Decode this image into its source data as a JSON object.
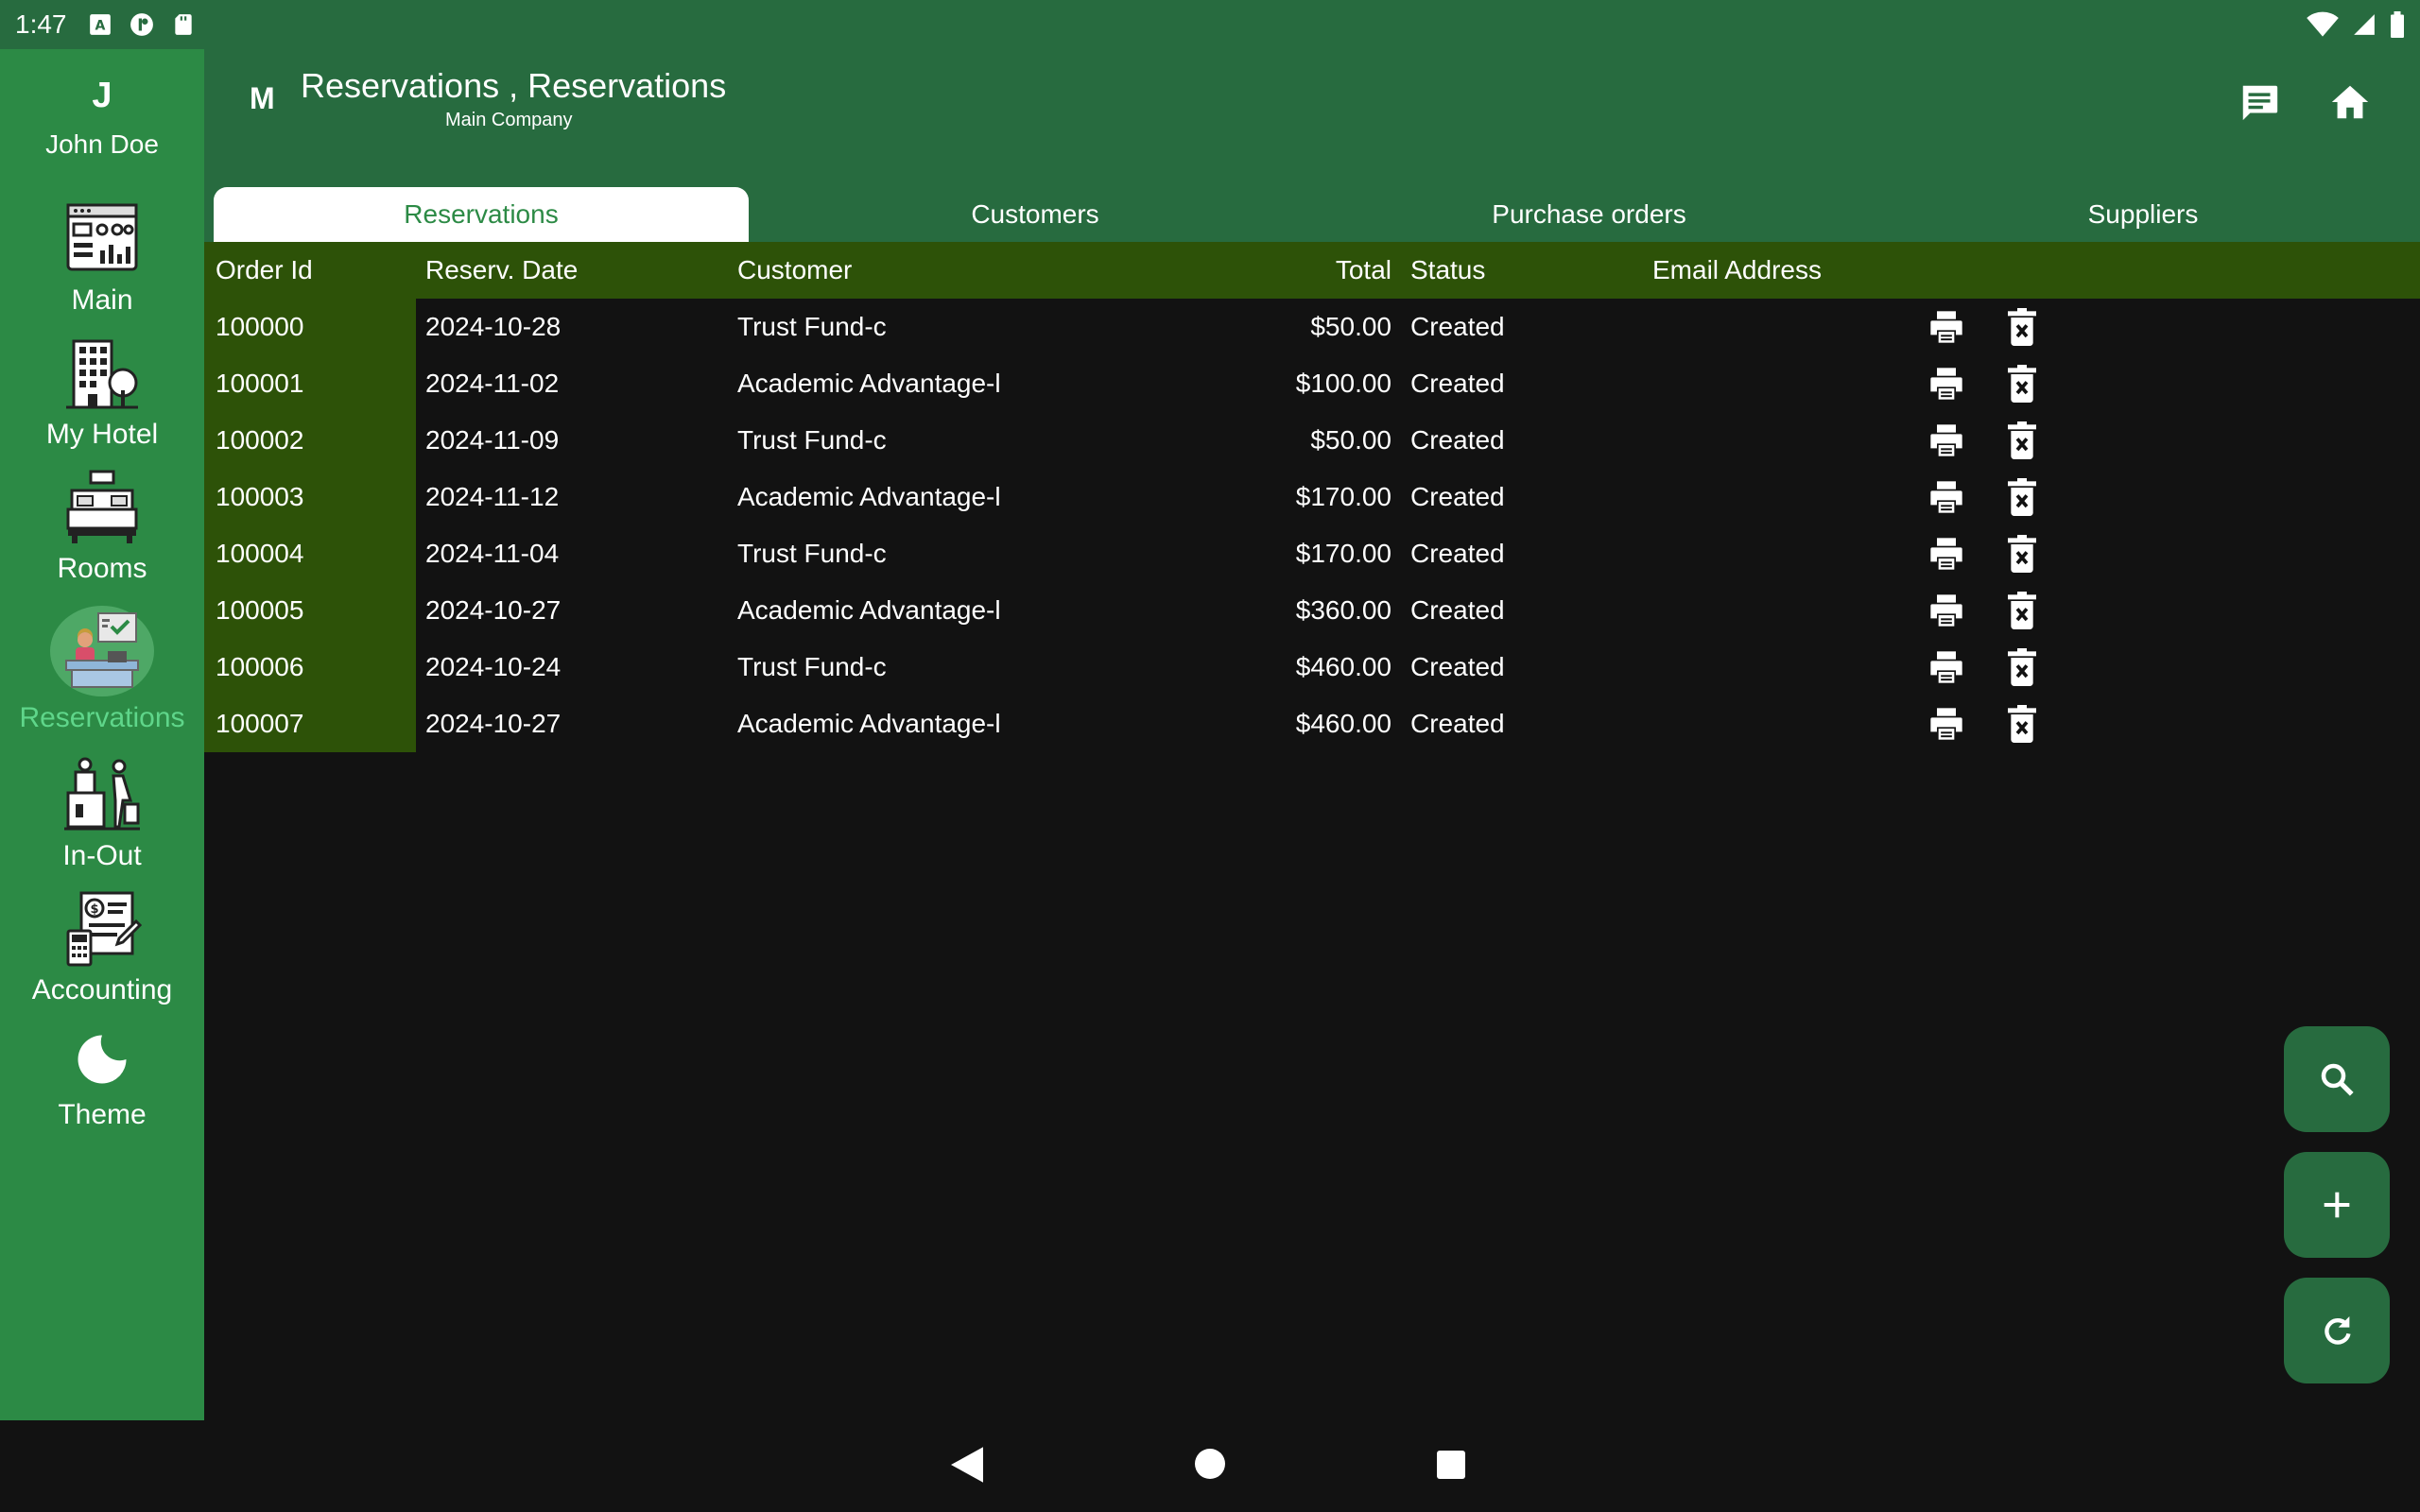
{
  "status_bar": {
    "time": "1:47"
  },
  "sidebar": {
    "user_initial": "J",
    "user_name": "John Doe",
    "items": [
      {
        "label": "Main",
        "icon": "dashboard-icon"
      },
      {
        "label": "My Hotel",
        "icon": "hotel-icon"
      },
      {
        "label": "Rooms",
        "icon": "bed-icon"
      },
      {
        "label": "Reservations",
        "icon": "reception-desk-icon"
      },
      {
        "label": "In-Out",
        "icon": "check-in-out-icon"
      },
      {
        "label": "Accounting",
        "icon": "accounting-icon"
      },
      {
        "label": "Theme",
        "icon": "moon-icon"
      }
    ]
  },
  "header": {
    "company_initial": "M",
    "title": "Reservations , Reservations",
    "subtitle": "Main Company"
  },
  "tabs": [
    {
      "label": "Reservations",
      "active": true
    },
    {
      "label": "Customers"
    },
    {
      "label": "Purchase orders"
    },
    {
      "label": "Suppliers"
    }
  ],
  "table": {
    "columns": {
      "order_id": "Order Id",
      "date": "Reserv. Date",
      "customer": "Customer",
      "total": "Total",
      "status": "Status",
      "email": "Email Address"
    },
    "rows": [
      {
        "order_id": "100000",
        "date": "2024-10-28",
        "customer": "Trust Fund-c",
        "total": "$50.00",
        "status": "Created",
        "email": ""
      },
      {
        "order_id": "100001",
        "date": "2024-11-02",
        "customer": "Academic Advantage-l",
        "total": "$100.00",
        "status": "Created",
        "email": ""
      },
      {
        "order_id": "100002",
        "date": "2024-11-09",
        "customer": "Trust Fund-c",
        "total": "$50.00",
        "status": "Created",
        "email": ""
      },
      {
        "order_id": "100003",
        "date": "2024-11-12",
        "customer": "Academic Advantage-l",
        "total": "$170.00",
        "status": "Created",
        "email": ""
      },
      {
        "order_id": "100004",
        "date": "2024-11-04",
        "customer": "Trust Fund-c",
        "total": "$170.00",
        "status": "Created",
        "email": ""
      },
      {
        "order_id": "100005",
        "date": "2024-10-27",
        "customer": "Academic Advantage-l",
        "total": "$360.00",
        "status": "Created",
        "email": ""
      },
      {
        "order_id": "100006",
        "date": "2024-10-24",
        "customer": "Trust Fund-c",
        "total": "$460.00",
        "status": "Created",
        "email": ""
      },
      {
        "order_id": "100007",
        "date": "2024-10-27",
        "customer": "Academic Advantage-l",
        "total": "$460.00",
        "status": "Created",
        "email": ""
      }
    ]
  },
  "colors": {
    "header_green": "#276b3f",
    "sidebar_green": "#2c8a45",
    "table_header": "#2d5208",
    "active_text": "#5fd68a",
    "background": "#121212"
  }
}
